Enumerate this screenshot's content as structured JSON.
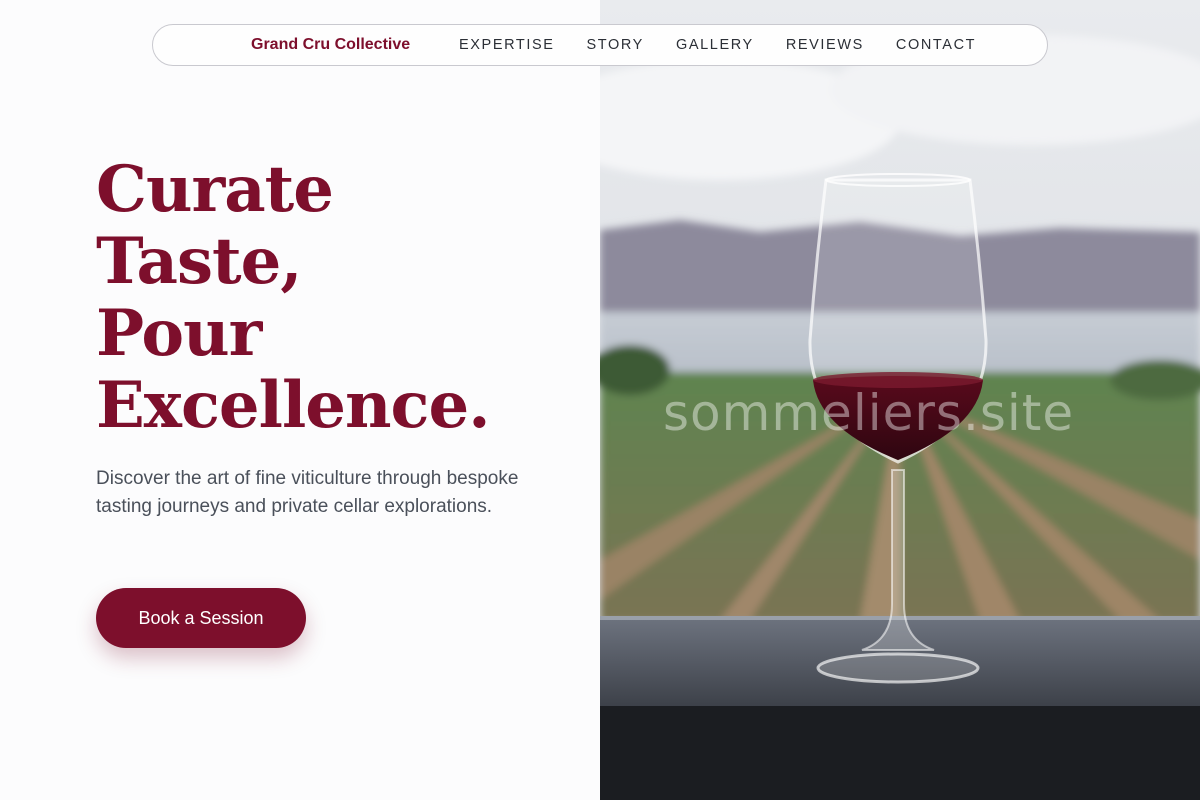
{
  "nav": {
    "brand": "Grand Cru Collective",
    "links": [
      "EXPERTISE",
      "STORY",
      "GALLERY",
      "REVIEWS",
      "CONTACT"
    ]
  },
  "hero": {
    "headline_lines": [
      "Curate",
      "Taste,",
      "Pour",
      "Excellence."
    ],
    "subtitle": "Discover the art of fine viticulture through bespoke tasting journeys and private cellar explorations.",
    "cta_label": "Book a Session"
  },
  "image": {
    "watermark": "sommeliers.site",
    "subject": "wine-glass-over-vineyard"
  },
  "colors": {
    "brand": "#7d0f2c",
    "text_dark": "#2b2f36",
    "text_muted": "#4a505a",
    "background": "#fcfcfd"
  }
}
